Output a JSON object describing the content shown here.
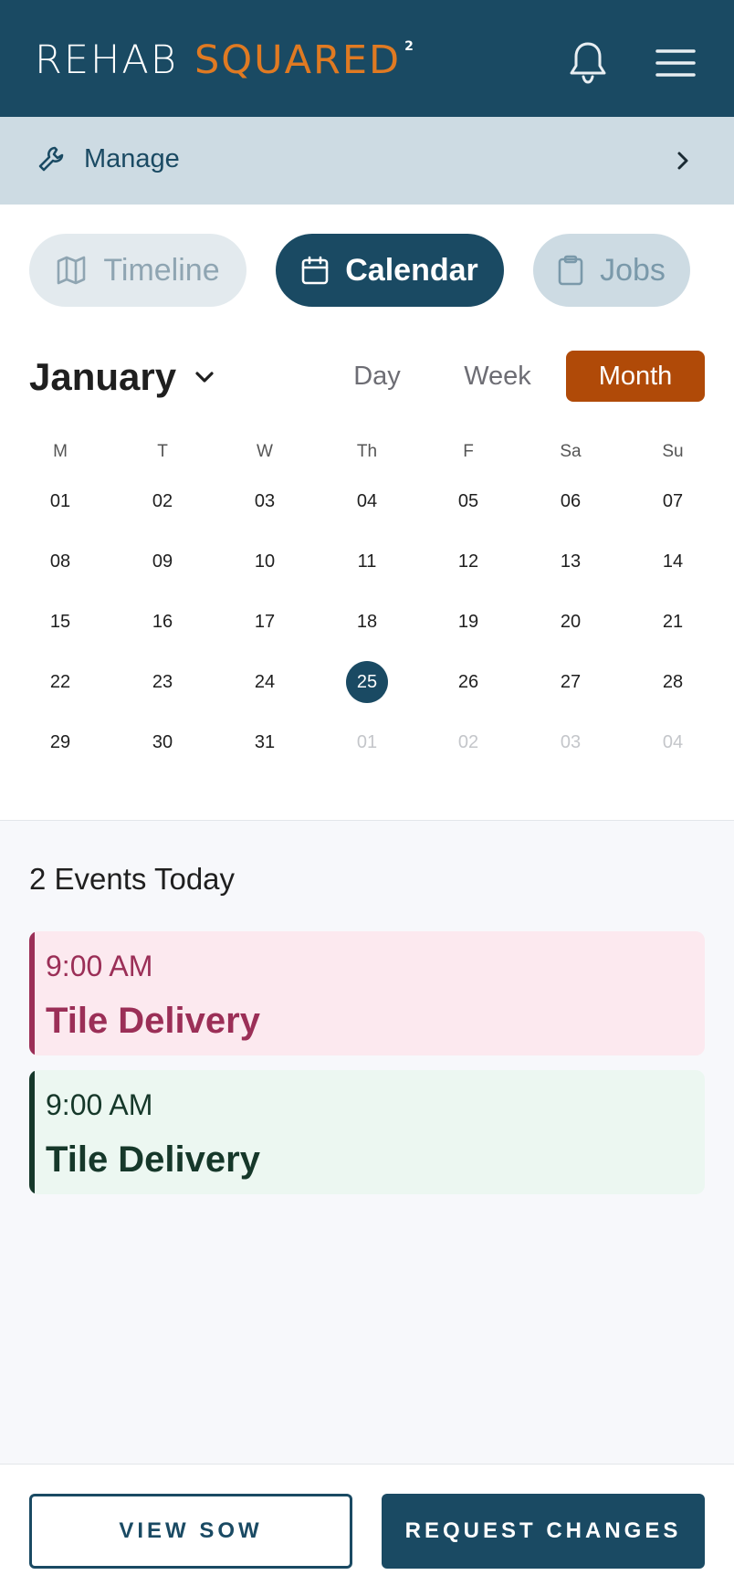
{
  "header": {
    "logo_part1": "REHAB",
    "logo_part2": "SQUARED",
    "logo_sup": "2",
    "bell_icon": "bell-icon",
    "menu_icon": "hamburger-menu-icon"
  },
  "manage": {
    "label": "Manage",
    "icon": "wrench-icon",
    "chevron": "chevron-right-icon"
  },
  "view_tabs": [
    {
      "label": "Timeline",
      "icon": "map-icon",
      "active": false
    },
    {
      "label": "Calendar",
      "icon": "calendar-icon",
      "active": true
    },
    {
      "label": "Jobs",
      "icon": "clipboard-icon",
      "active": false
    }
  ],
  "calendar": {
    "month": "January",
    "range_options": [
      {
        "label": "Day",
        "active": false
      },
      {
        "label": "Week",
        "active": false
      },
      {
        "label": "Month",
        "active": true
      }
    ],
    "weekdays": [
      "M",
      "T",
      "W",
      "Th",
      "F",
      "Sa",
      "Su"
    ],
    "weeks": [
      [
        "01",
        "02",
        "03",
        "04",
        "05",
        "06",
        "07"
      ],
      [
        "08",
        "09",
        "10",
        "11",
        "12",
        "13",
        "14"
      ],
      [
        "15",
        "16",
        "17",
        "18",
        "19",
        "20",
        "21"
      ],
      [
        "22",
        "23",
        "24",
        "25",
        "26",
        "27",
        "28"
      ],
      [
        "29",
        "30",
        "31",
        "01",
        "02",
        "03",
        "04"
      ]
    ],
    "today": "25",
    "muted_days_last_week": [
      "01",
      "02",
      "03",
      "04"
    ]
  },
  "events": {
    "title": "2 Events Today",
    "items": [
      {
        "time": "9:00 AM",
        "name": "Tile Delivery",
        "color": "#9b2f57"
      },
      {
        "time": "9:00 AM",
        "name": "Tile Delivery",
        "color": "#16382a"
      }
    ]
  },
  "footer": {
    "view_sow": "VIEW SOW",
    "request_changes": "REQUEST CHANGES"
  },
  "colors": {
    "primary": "#1a4a63",
    "accent_orange": "#e07a22",
    "month_active": "#b04a08"
  }
}
